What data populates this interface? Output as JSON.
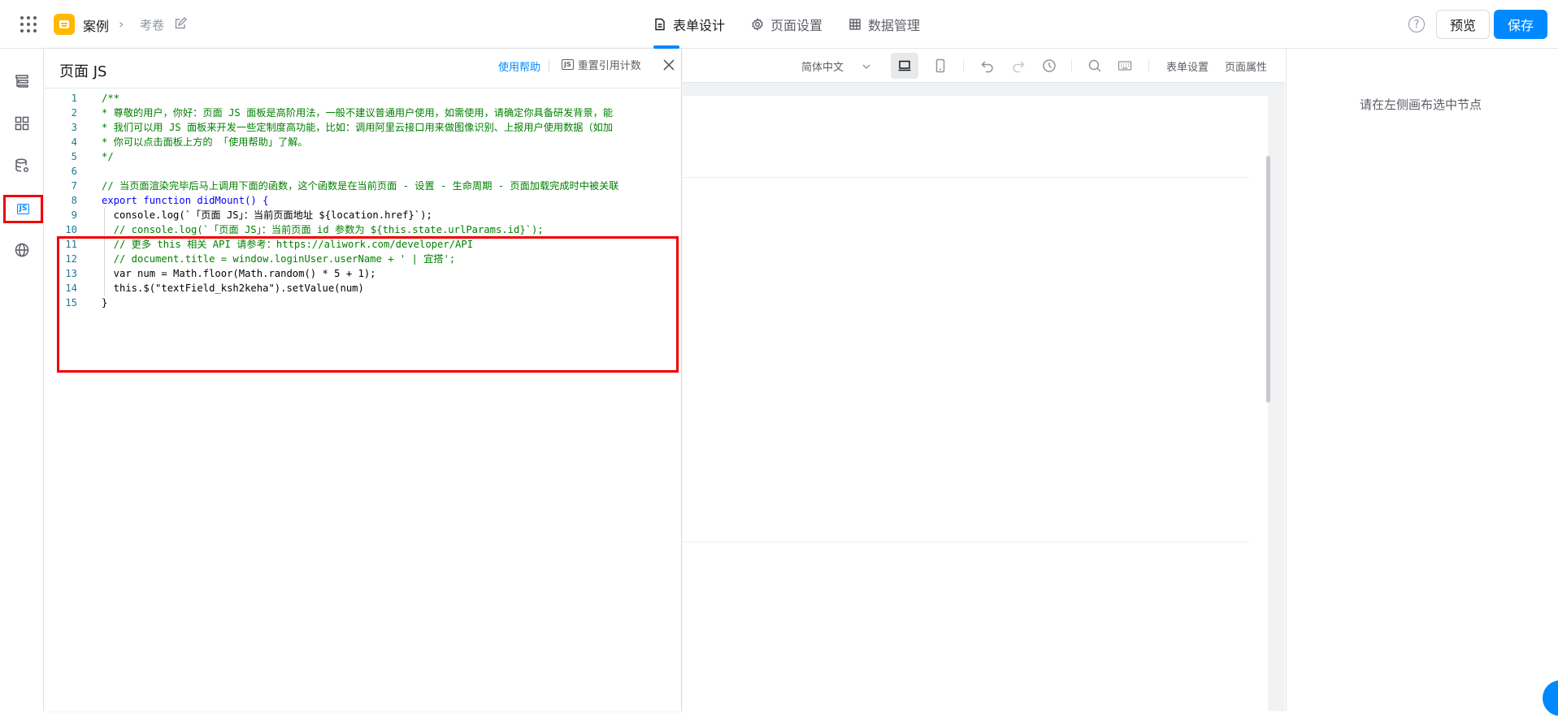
{
  "header": {
    "app_name": "案例",
    "page_name": "考卷",
    "tabs": [
      {
        "label": "表单设计",
        "icon": "form-design-icon",
        "active": true
      },
      {
        "label": "页面设置",
        "icon": "gear-icon",
        "active": false
      },
      {
        "label": "数据管理",
        "icon": "table-icon",
        "active": false
      }
    ],
    "help_glyph": "?",
    "preview_label": "预览",
    "save_label": "保存"
  },
  "rail": {
    "items": [
      "outline-icon",
      "components-icon",
      "datasource-icon",
      "js-icon",
      "globe-icon"
    ],
    "js_label": "JS"
  },
  "js_panel": {
    "title": "页面 JS",
    "help_link": "使用帮助",
    "reset_badge": "JS",
    "reset_label": "重置引用计数",
    "lines": [
      {
        "n": "1",
        "code": "/**"
      },
      {
        "n": "2",
        "code": "* 尊敬的用户，你好：页面 JS 面板是高阶用法，一般不建议普通用户使用，如需使用，请确定你具备研发背景，能"
      },
      {
        "n": "3",
        "code": "* 我们可以用 JS 面板来开发一些定制度高功能，比如：调用阿里云接口用来做图像识别、上报用户使用数据（如加"
      },
      {
        "n": "4",
        "code": "* 你可以点击面板上方的 「使用帮助」了解。"
      },
      {
        "n": "5",
        "code": "*/"
      },
      {
        "n": "6",
        "code": ""
      },
      {
        "n": "7",
        "code": "// 当页面渲染完毕后马上调用下面的函数，这个函数是在当前页面 - 设置 - 生命周期 - 页面加载完成时中被关联"
      },
      {
        "n": "8",
        "code": "export function didMount() {"
      },
      {
        "n": "9",
        "code": "  console.log(`「页面 JS」：当前页面地址 ${location.href}`);"
      },
      {
        "n": "10",
        "code": "  // console.log(`「页面 JS」：当前页面 id 参数为 ${this.state.urlParams.id}`);"
      },
      {
        "n": "11",
        "code": "  // 更多 this 相关 API 请参考：https://aliwork.com/developer/API"
      },
      {
        "n": "12",
        "code": "  // document.title = window.loginUser.userName + ' | 宜搭';"
      },
      {
        "n": "13",
        "code": "  var num = Math.floor(Math.random() * 5 + 1);"
      },
      {
        "n": "14",
        "code": "  this.$(\"textField_ksh2keha\").setValue(num)"
      },
      {
        "n": "15",
        "code": "}"
      }
    ]
  },
  "toolbar": {
    "language": "简体中文",
    "form_settings": "表单设置",
    "page_props": "页面属性"
  },
  "right_panel": {
    "hint": "请在左侧画布选中节点"
  },
  "colors": {
    "accent": "#0089ff",
    "highlight_box": "#f00000",
    "comment": "#008000",
    "keyword": "#0000ff",
    "string": "#a31515"
  }
}
